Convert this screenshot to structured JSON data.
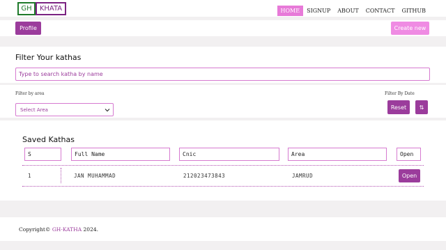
{
  "nav": {
    "logo_gh": "GH",
    "logo_khata": "KHATA",
    "links": [
      "HOME",
      "SIGNUP",
      "ABOUT",
      "CONTACT",
      "GITHUB"
    ]
  },
  "toolbar": {
    "profile_label": "Profile",
    "create_label": "Create new"
  },
  "filter": {
    "title": "Filter Your kathas",
    "search_placeholder": "Type to search katha by name",
    "area_label": "Filter by area",
    "area_select": "Select Area",
    "date_label": "Filter By Date",
    "reset_label": "Reset",
    "sort_label": "⇅"
  },
  "table": {
    "title": "Saved Kathas",
    "headers": [
      "S",
      "Full Name",
      "Cnic",
      "Area",
      "Open"
    ],
    "rows": [
      {
        "s": "1",
        "name": "JAN MUHAMMAD",
        "cnic": "212023473843",
        "area": "JAMRUD",
        "open": "Open"
      }
    ]
  },
  "footer": {
    "prefix": "Copyright© ",
    "brand": "GH-KATHA",
    "suffix": " 2024."
  },
  "colors": {
    "accent": "#9b3c9c",
    "accent_light": "#ef8be3",
    "border": "#d67ad0",
    "logo_green": "#1f7a2a"
  }
}
